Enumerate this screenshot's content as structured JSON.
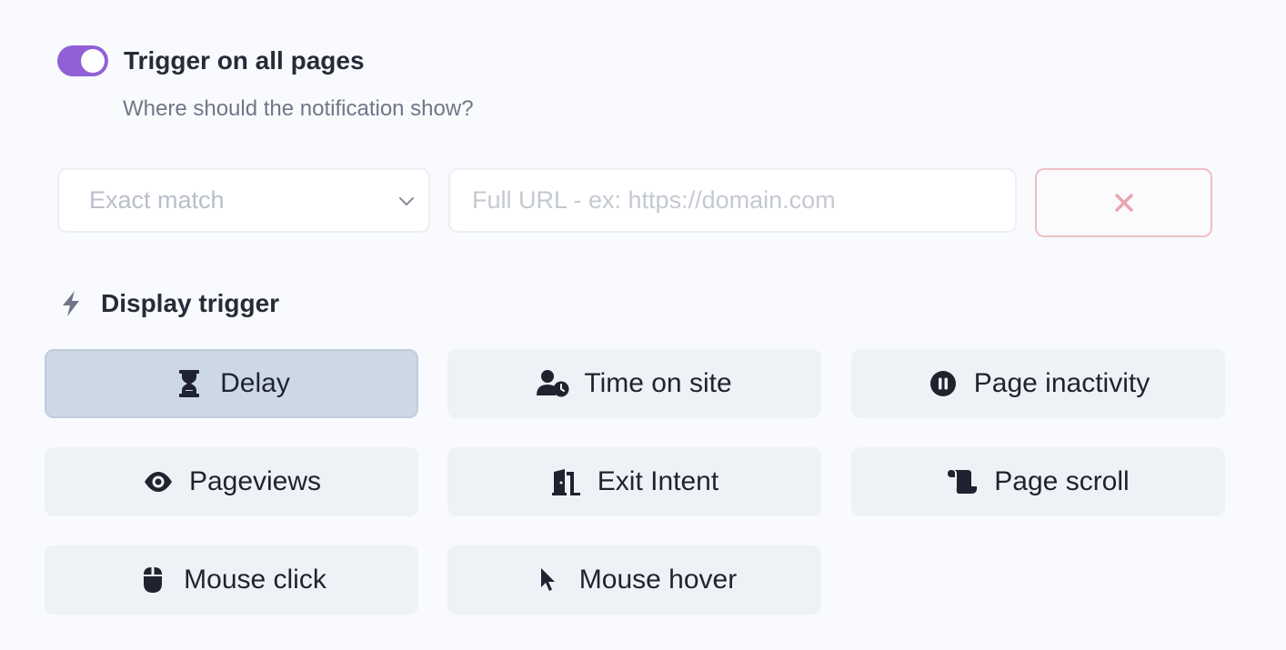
{
  "targeting": {
    "toggle_label": "Trigger on all pages",
    "toggle_on": true,
    "hint": "Where should the notification show?",
    "match_select": {
      "value": "Exact match"
    },
    "url_input": {
      "value": "",
      "placeholder": "Full URL - ex: https://domain.com"
    },
    "remove_icon": "close-icon"
  },
  "display_trigger": {
    "title": "Display trigger",
    "icon": "bolt-icon",
    "options": [
      {
        "label": "Delay",
        "icon": "hourglass-icon",
        "active": true
      },
      {
        "label": "Time on site",
        "icon": "user-clock-icon",
        "active": false
      },
      {
        "label": "Page inactivity",
        "icon": "pause-circle-icon",
        "active": false
      },
      {
        "label": "Pageviews",
        "icon": "eye-icon",
        "active": false
      },
      {
        "label": "Exit Intent",
        "icon": "door-open-icon",
        "active": false
      },
      {
        "label": "Page scroll",
        "icon": "scroll-icon",
        "active": false
      },
      {
        "label": "Mouse click",
        "icon": "mouse-icon",
        "active": false
      },
      {
        "label": "Mouse hover",
        "icon": "pointer-icon",
        "active": false
      }
    ]
  },
  "colors": {
    "accent": "#9061d6",
    "active_trigger_bg": "#cdd8e6",
    "trigger_bg": "#eef1f5",
    "danger_border": "#eebfc6",
    "danger_icon": "#e8a6b0"
  }
}
